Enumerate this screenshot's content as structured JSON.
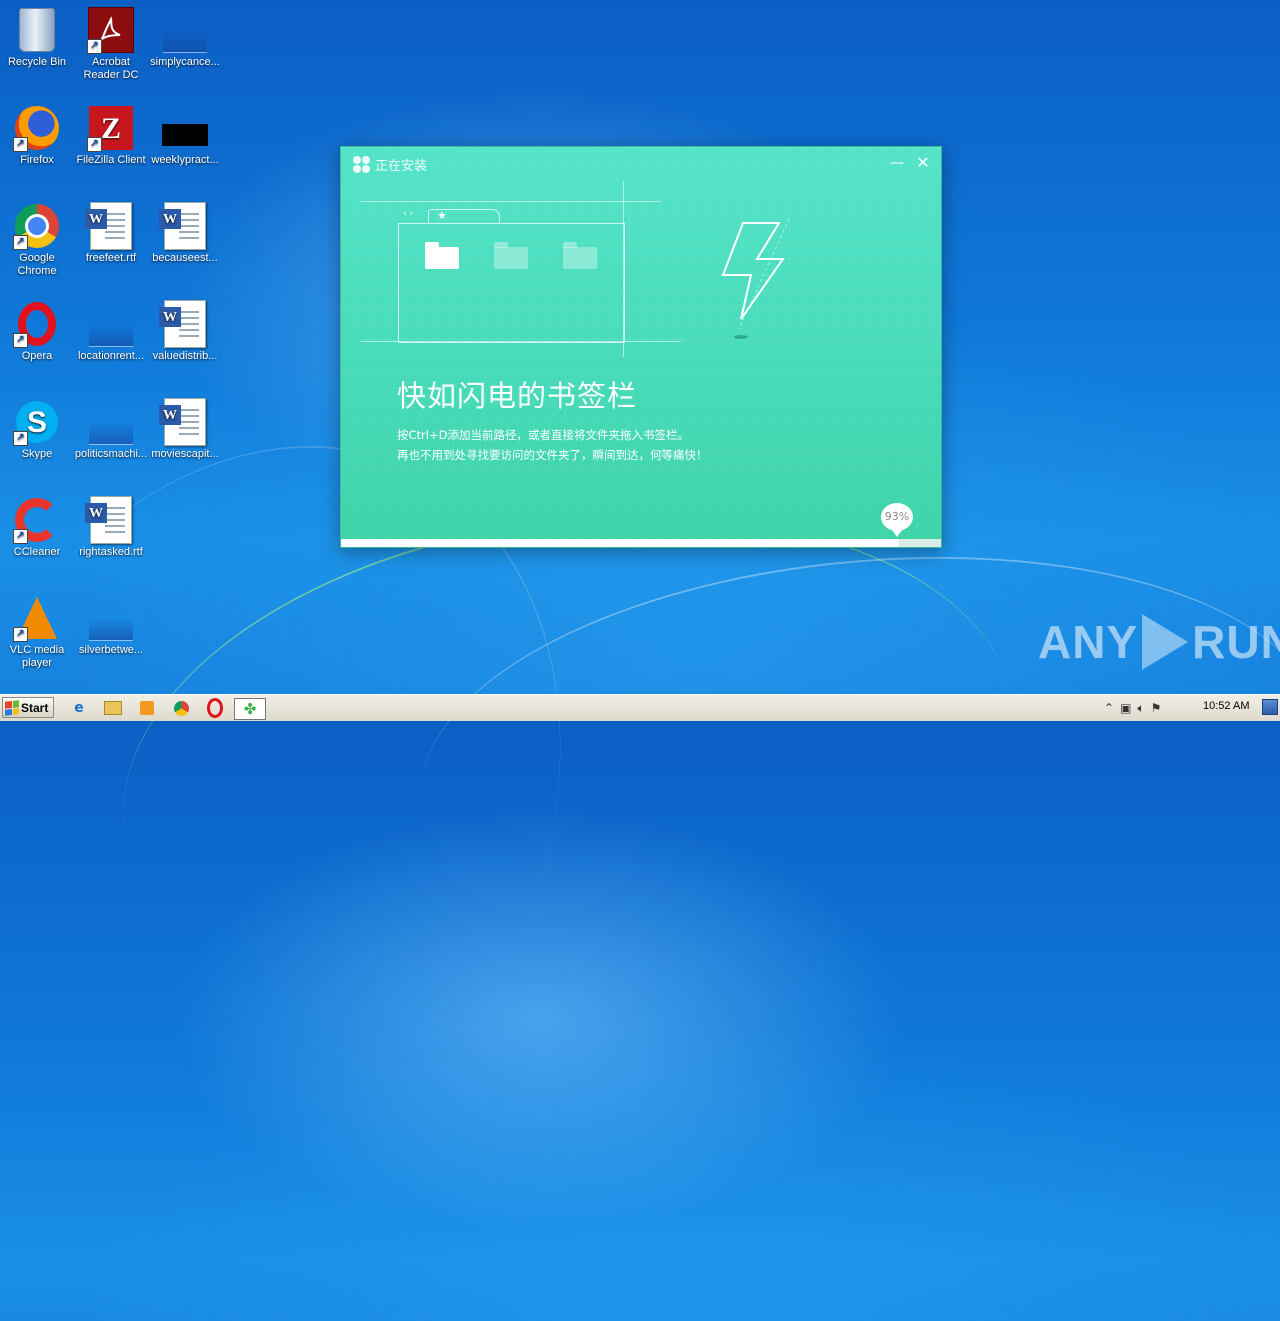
{
  "desktop": {
    "icons": [
      {
        "label": "Recycle Bin"
      },
      {
        "label": "Acrobat Reader DC"
      },
      {
        "label": "simplycance..."
      },
      {
        "label": "Firefox"
      },
      {
        "label": "FileZilla Client"
      },
      {
        "label": "weeklypract..."
      },
      {
        "label": "Google Chrome"
      },
      {
        "label": "freefeet.rtf"
      },
      {
        "label": "becauseest..."
      },
      {
        "label": "Opera"
      },
      {
        "label": "locationrent..."
      },
      {
        "label": "valuedistrib..."
      },
      {
        "label": "Skype"
      },
      {
        "label": "politicsmachi..."
      },
      {
        "label": "moviescapit..."
      },
      {
        "label": "CCleaner"
      },
      {
        "label": "rightasked.rtf"
      },
      {
        "label": "VLC media player"
      },
      {
        "label": "silverbetwe..."
      }
    ]
  },
  "installer": {
    "title": "正在安装",
    "minimize_glyph": "—",
    "close_glyph": "✕",
    "headline": "快如闪电的书签栏",
    "desc_line1": "按Ctrl+D添加当前路径，或者直接将文件夹拖入书签栏。",
    "desc_line2": "再也不用到处寻找要访问的文件夹了，瞬间到达，何等痛快！",
    "progress_label": "93%",
    "progress_value": 0.93
  },
  "taskbar": {
    "start_label": "Start",
    "clock": "10:52 AM"
  },
  "watermark": {
    "text_left": "ANY",
    "text_right": "RUN"
  }
}
